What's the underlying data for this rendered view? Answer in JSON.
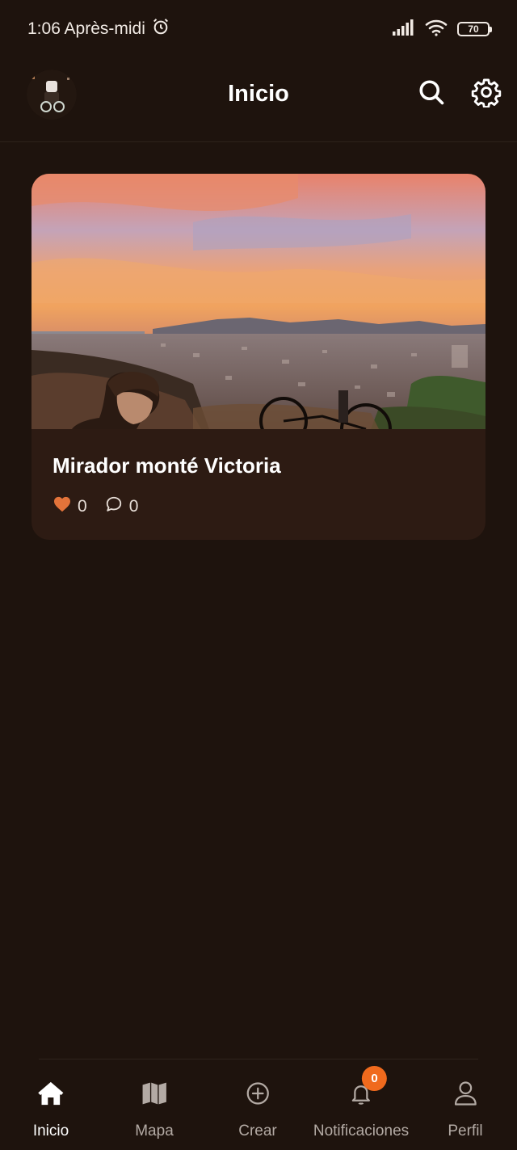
{
  "status_bar": {
    "time": "1:06 Après-midi",
    "battery": "70",
    "icons": [
      "alarm-icon",
      "signal-icon",
      "wifi-icon",
      "battery-icon"
    ]
  },
  "header": {
    "title": "Inicio",
    "icons": [
      "avatar",
      "search-icon",
      "gear-icon"
    ]
  },
  "feed": {
    "posts": [
      {
        "title": "Mirador monté Victoria",
        "likes": "0",
        "comments": "0"
      }
    ]
  },
  "bottom_nav": {
    "items": [
      {
        "label": "Inicio",
        "icon": "home-icon",
        "active": true
      },
      {
        "label": "Mapa",
        "icon": "map-icon",
        "active": false
      },
      {
        "label": "Crear",
        "icon": "plus-circle-icon",
        "active": false
      },
      {
        "label": "Notificaciones",
        "icon": "bell-icon",
        "active": false,
        "badge": "0"
      },
      {
        "label": "Perfil",
        "icon": "user-icon",
        "active": false
      }
    ]
  },
  "colors": {
    "background": "#1e130d",
    "card": "#2d1b13",
    "accent": "#f06a1d",
    "like": "#e3733a"
  }
}
